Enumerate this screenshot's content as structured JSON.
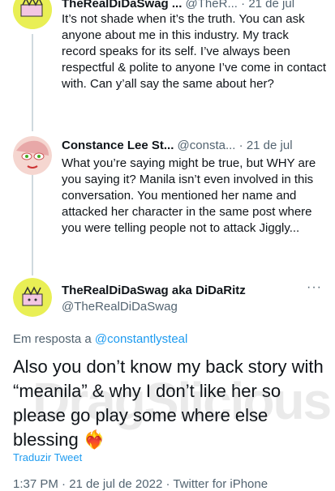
{
  "tweet1": {
    "name": "TheRealDiDaSwag ...",
    "handle": "@TheR...",
    "sep": "·",
    "date": "21 de jul",
    "text": "It’s not shade when it’s the truth. You can ask anyone about me in this industry. My track record speaks for its self. I’ve always been respectful & polite to anyone I’ve come in contact with. Can y’all say the same about her?"
  },
  "tweet2": {
    "name": "Constance Lee St...",
    "handle": "@consta...",
    "sep": "·",
    "date": "21 de jul",
    "text": "What you’re saying might be true, but WHY are you saying it? Manila isn’t even involved in this conversation. You mentioned her name and attacked her character in the same post where you were telling people not to attack Jiggly..."
  },
  "main": {
    "name": "TheRealDiDaSwag aka DiDaRitz",
    "handle": "@TheRealDiDaSwag",
    "reply_prefix": "Em resposta a ",
    "reply_to": "@constantlysteal",
    "text": "Also you don’t know my back story with “meanila” & why I don’t like her so please go play some where else blessing",
    "emoji": "❤️‍🔥",
    "translate": "Traduzir Tweet",
    "timestamp": "1:37 PM · 21 de jul de 2022 · Twitter for iPhone",
    "more": "···"
  },
  "watermark": "DragSlicious",
  "colors": {
    "link": "#1d9bf0",
    "secondary": "#536471",
    "thread_line": "#cfd9de"
  }
}
